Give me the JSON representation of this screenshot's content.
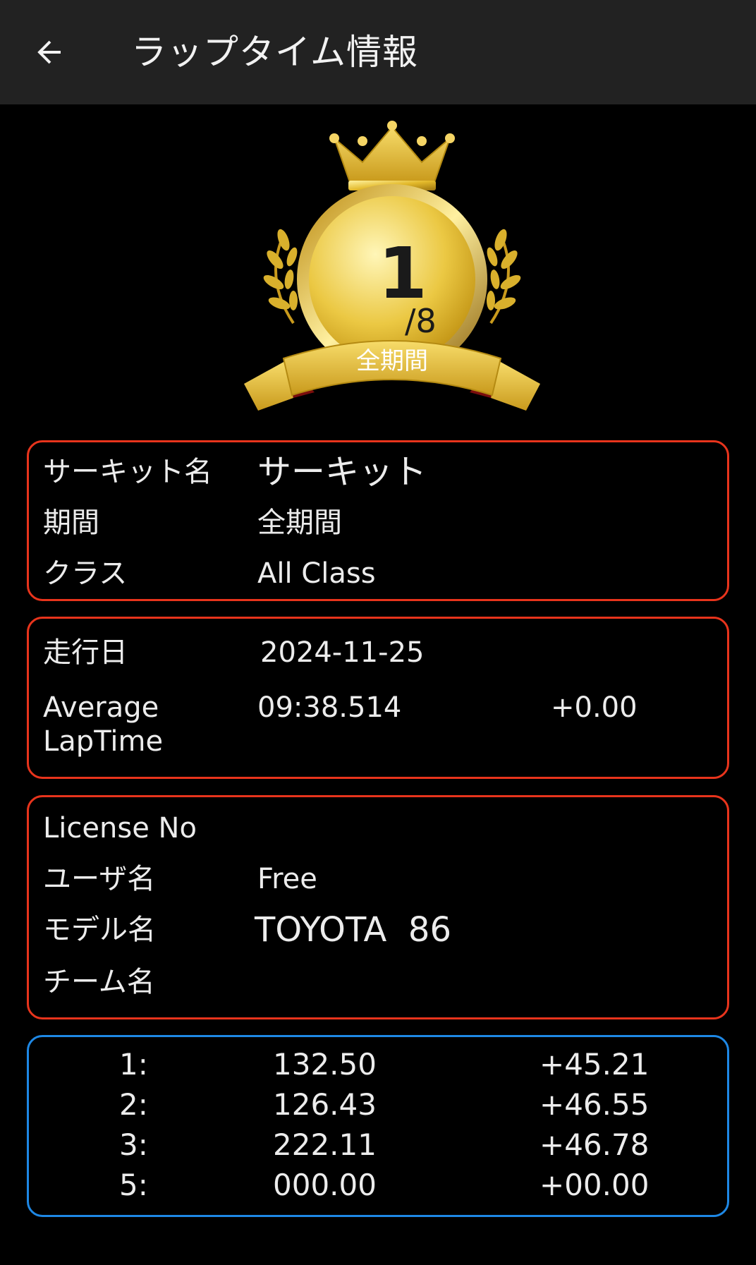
{
  "appbar": {
    "title": "ラップタイム情報",
    "back_icon": "arrow-left-icon"
  },
  "badge": {
    "rank": "1",
    "total": "/8",
    "period": "全期間",
    "colors": {
      "gold_light": "#fff3a0",
      "gold": "#e3b92a",
      "gold_dark": "#9c7410",
      "ribbon_end": "#7a0d0d"
    }
  },
  "circuit_card": {
    "circuit_label": "サーキット名",
    "circuit_value": "サーキット",
    "period_label": "期間",
    "period_value": "全期間",
    "class_label": "クラス",
    "class_value": "All Class"
  },
  "run_card": {
    "date_label": "走行日",
    "date_value": "2024-11-25",
    "avg_label_line1": "Average",
    "avg_label_line2": "LapTime",
    "avg_value": "09:38.514",
    "avg_diff": "+0.00"
  },
  "user_card": {
    "license_label": "License No",
    "license_value": "",
    "user_label": "ユーザ名",
    "user_value": "Free",
    "model_label": "モデル名",
    "model_value": "TOYOTA  86",
    "team_label": "チーム名",
    "team_value": ""
  },
  "laps": [
    {
      "index": "1:",
      "time": "132.50",
      "gap": "+45.21"
    },
    {
      "index": "2:",
      "time": "126.43",
      "gap": "+46.55"
    },
    {
      "index": "3:",
      "time": "222.11",
      "gap": "+46.78"
    },
    {
      "index": "5:",
      "time": "000.00",
      "gap": "+00.00"
    }
  ],
  "colors": {
    "appbar": "#222222",
    "background": "#000000",
    "card_border_red": "#e8341c",
    "card_border_blue": "#1e88e5",
    "text": "#ececec"
  }
}
